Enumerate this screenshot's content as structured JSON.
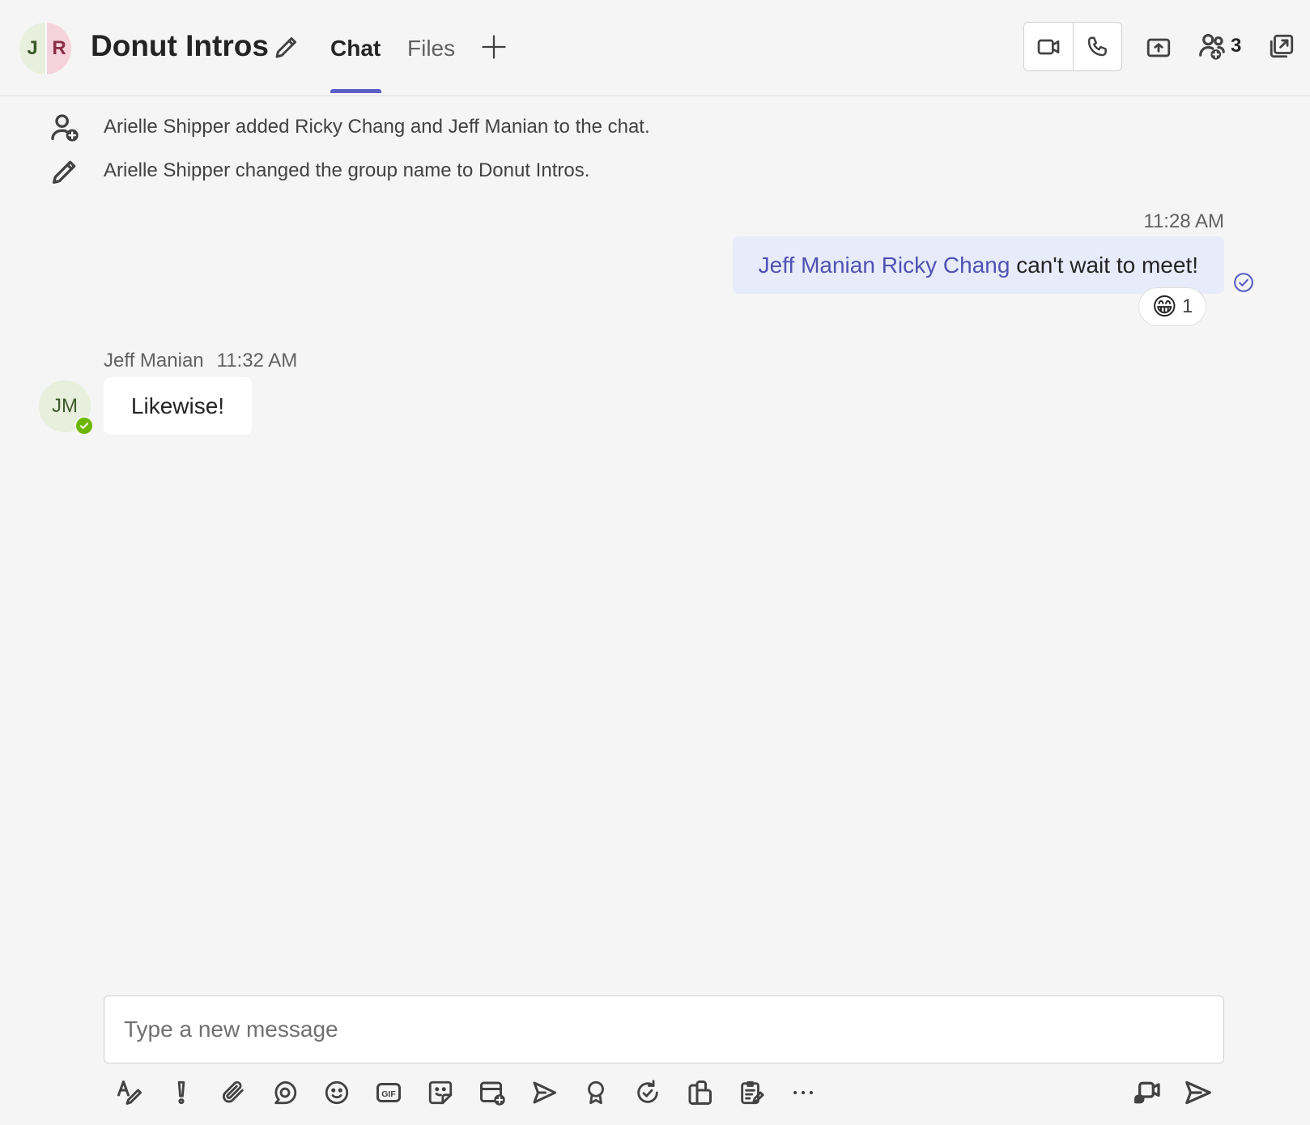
{
  "header": {
    "avatar_initials": [
      "J",
      "R"
    ],
    "title": "Donut Intros",
    "tabs": [
      {
        "label": "Chat",
        "active": true
      },
      {
        "label": "Files",
        "active": false
      }
    ],
    "participant_count": "3",
    "accent_color": "#5b5fc7"
  },
  "events": [
    {
      "icon": "person-add-icon",
      "text": "Arielle Shipper added Ricky Chang and Jeff Manian to the chat."
    },
    {
      "icon": "pencil-icon",
      "text": "Arielle Shipper changed the group name to Donut Intros."
    }
  ],
  "messages": {
    "sent": {
      "time": "11:28 AM",
      "mention1": "Jeff Manian",
      "mention2": "Ricky Chang",
      "text": "can't wait to meet!",
      "reaction_emoji": "😁",
      "reaction_count": "1"
    },
    "received": {
      "author": "Jeff Manian",
      "time": "11:32 AM",
      "initials": "JM",
      "text": "Likewise!",
      "presence": "available"
    }
  },
  "compose": {
    "placeholder": "Type a new message"
  },
  "toolbar": {
    "icons": [
      "format-icon",
      "important-icon",
      "attach-icon",
      "loop-icon",
      "emoji-icon",
      "gif-icon",
      "sticker-icon",
      "schedule-meeting-icon",
      "stream-icon",
      "praise-icon",
      "updates-icon",
      "apps-icon",
      "forms-icon",
      "more-icon",
      "meet-now-icon",
      "send-icon"
    ]
  }
}
